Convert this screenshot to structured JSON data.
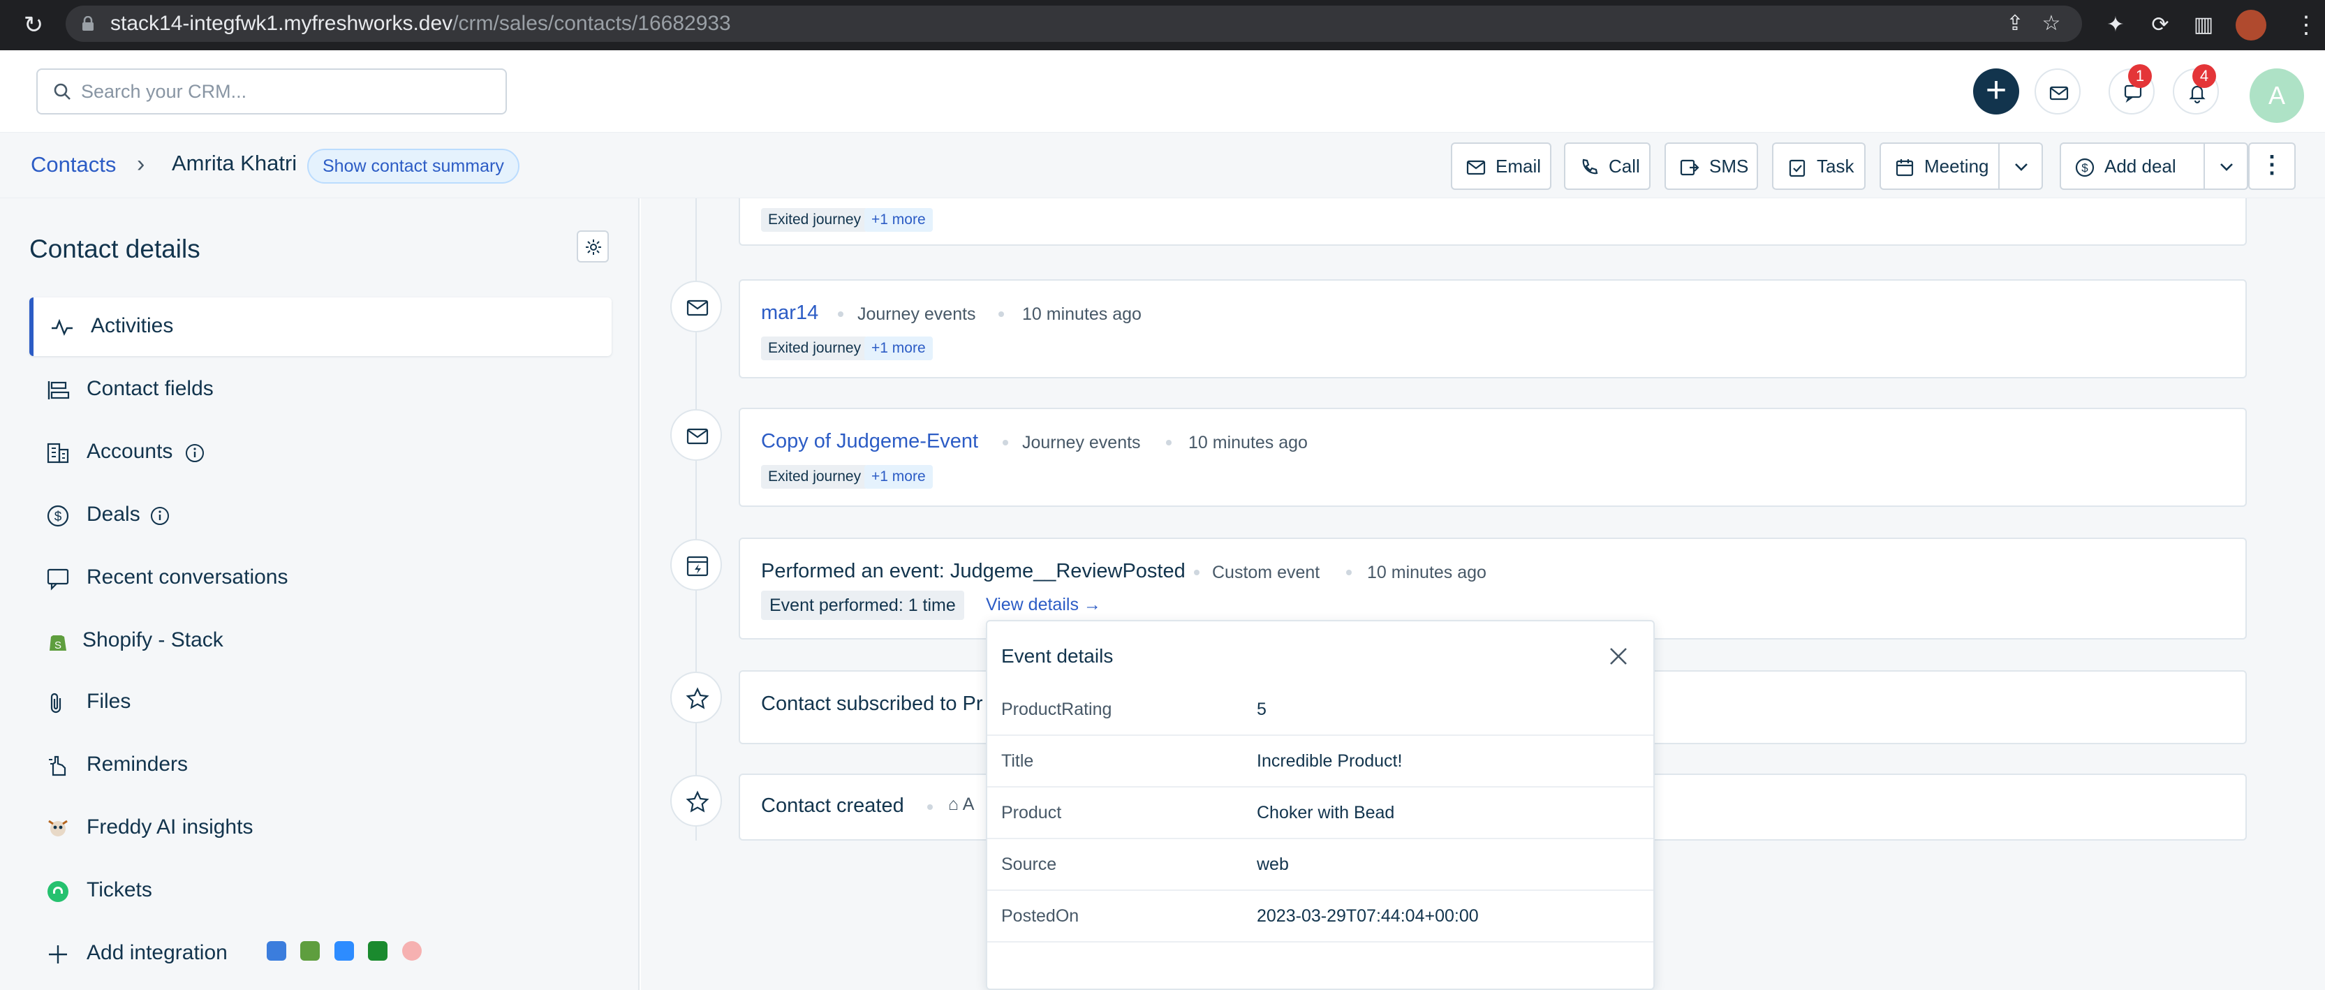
{
  "browser": {
    "url_host": "stack14-integfwk1.myfreshworks.dev",
    "url_path": "/crm/sales/contacts/16682933"
  },
  "topbar": {
    "search_placeholder": "Search your CRM...",
    "notification_badges": [
      "1",
      "4"
    ],
    "avatar_initial": "A"
  },
  "breadcrumb": {
    "parent": "Contacts",
    "current": "Amrita Khatri",
    "summary_button": "Show contact summary"
  },
  "actions": {
    "email": "Email",
    "call": "Call",
    "sms": "SMS",
    "task": "Task",
    "meeting": "Meeting",
    "add_deal": "Add deal"
  },
  "left_panel": {
    "title": "Contact details",
    "items": [
      {
        "label": "Activities",
        "icon": "activity-icon"
      },
      {
        "label": "Contact fields",
        "icon": "fields-icon"
      },
      {
        "label": "Accounts",
        "icon": "building-icon"
      },
      {
        "label": "Deals",
        "icon": "dollar-icon"
      },
      {
        "label": "Recent conversations",
        "icon": "chat-icon"
      },
      {
        "label": "Shopify - Stack",
        "icon": "shopify-icon"
      },
      {
        "label": "Files",
        "icon": "paperclip-icon"
      },
      {
        "label": "Reminders",
        "icon": "reminder-icon"
      },
      {
        "label": "Freddy AI insights",
        "icon": "freddy-icon"
      },
      {
        "label": "Tickets",
        "icon": "tickets-icon"
      },
      {
        "label": "Add integration",
        "icon": "plus-icon"
      }
    ]
  },
  "timeline": {
    "top_card": {
      "tag": "Exited journey",
      "more": "+1 more"
    },
    "cards": [
      {
        "title": "mar14",
        "category": "Journey events",
        "time": "10 minutes ago",
        "tag": "Exited journey",
        "more": "+1 more"
      },
      {
        "title": "Copy of Judgeme-Event",
        "category": "Journey events",
        "time": "10 minutes ago",
        "tag": "Exited journey",
        "more": "+1 more"
      },
      {
        "title": "Performed an event: Judgeme__ReviewPosted",
        "category": "Custom event",
        "time": "10 minutes ago",
        "performed": "Event performed: 1 time",
        "view_details": "View details"
      },
      {
        "title": "Contact subscribed to Pr"
      },
      {
        "title": "Contact created",
        "extra": "A"
      }
    ]
  },
  "event_details": {
    "title": "Event details",
    "rows": [
      {
        "key": "ProductRating",
        "value": "5"
      },
      {
        "key": "Title",
        "value": "Incredible Product!"
      },
      {
        "key": "Product",
        "value": "Choker with Bead"
      },
      {
        "key": "Source",
        "value": "web"
      },
      {
        "key": "PostedOn",
        "value": "2023-03-29T07:44:04+00:00"
      }
    ]
  }
}
